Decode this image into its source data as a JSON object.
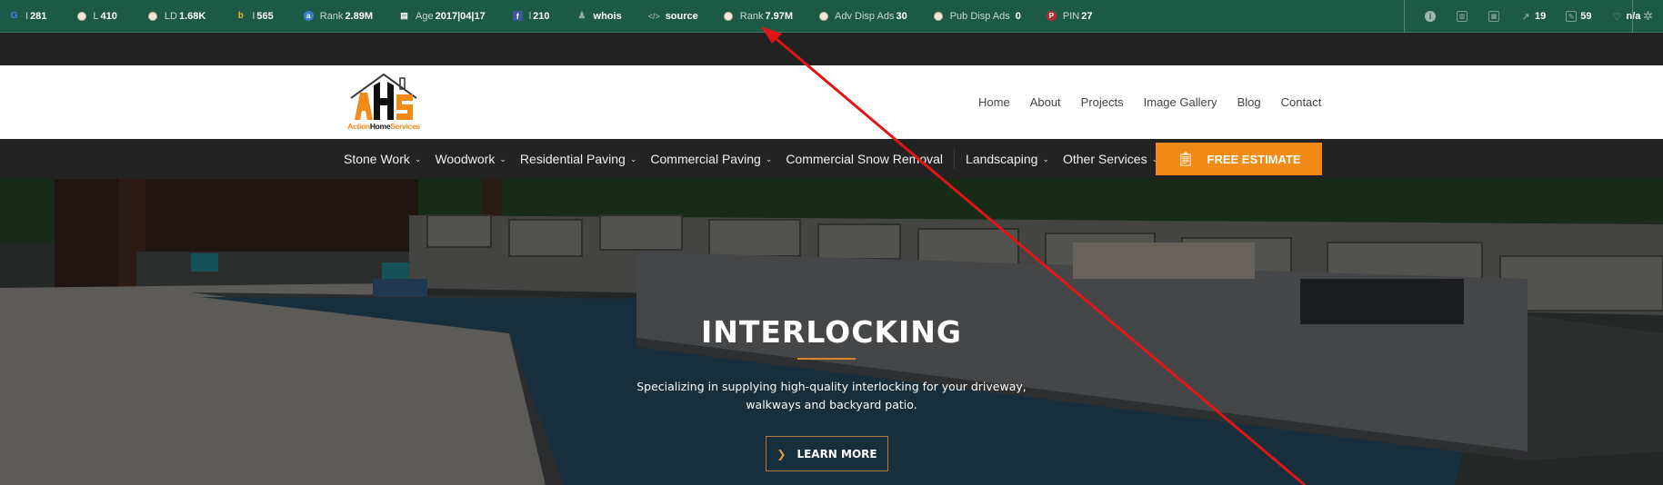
{
  "seo_toolbar": {
    "metrics": [
      {
        "icon": "google-icon",
        "label": "I",
        "value": "281"
      },
      {
        "icon": "majestic-icon",
        "label": "L",
        "value": "410"
      },
      {
        "icon": "majestic-icon",
        "label": "LD",
        "value": "1.68K"
      },
      {
        "icon": "bing-icon",
        "label": "I",
        "value": "565"
      },
      {
        "icon": "alexa-icon",
        "label": "Rank",
        "value": "2.89M"
      },
      {
        "icon": "calendar-icon",
        "label": "Age",
        "value": "2017|04|17"
      },
      {
        "icon": "facebook-icon",
        "label": "l",
        "value": "210"
      },
      {
        "icon": "user-icon",
        "label": "",
        "value": "whois"
      },
      {
        "icon": "code-icon",
        "label": "",
        "value": "source"
      },
      {
        "icon": "semrush-icon",
        "label": "Rank",
        "value": "7.97M"
      },
      {
        "icon": "semrush-icon",
        "label": "Adv Disp Ads",
        "value": "30"
      },
      {
        "icon": "semrush-icon",
        "label": "Pub Disp Ads",
        "value": "0"
      },
      {
        "icon": "pinterest-icon",
        "label": "PIN",
        "value": "27"
      }
    ],
    "right": {
      "external_links": "19",
      "internal_links": "59",
      "health": "n/a"
    }
  },
  "site": {
    "logo_text": {
      "part1": "Action",
      "part2": "Home",
      "part3": "Services"
    },
    "logo_letters": "AHS",
    "top_nav": [
      "Home",
      "About",
      "Projects",
      "Image Gallery",
      "Blog",
      "Contact"
    ],
    "menu": [
      {
        "label": "Stone Work",
        "dropdown": true
      },
      {
        "label": "Woodwork",
        "dropdown": true
      },
      {
        "label": "Residential Paving",
        "dropdown": true
      },
      {
        "label": "Commercial Paving",
        "dropdown": true
      },
      {
        "label": "Commercial Snow Removal",
        "dropdown": false
      },
      {
        "label": "Landscaping",
        "dropdown": true
      },
      {
        "label": "Other Services",
        "dropdown": true
      }
    ],
    "cta": "FREE ESTIMATE",
    "hero": {
      "title": "INTERLOCKING",
      "subtitle_line1": "Specializing in supplying high-quality interlocking for your driveway,",
      "subtitle_line2": "walkways and backyard patio.",
      "button": "LEARN MORE"
    }
  },
  "colors": {
    "toolbar_bg": "#1c5a45",
    "accent_orange": "#f28a17",
    "menu_bg": "#232323",
    "annotation_red": "#e01515"
  }
}
